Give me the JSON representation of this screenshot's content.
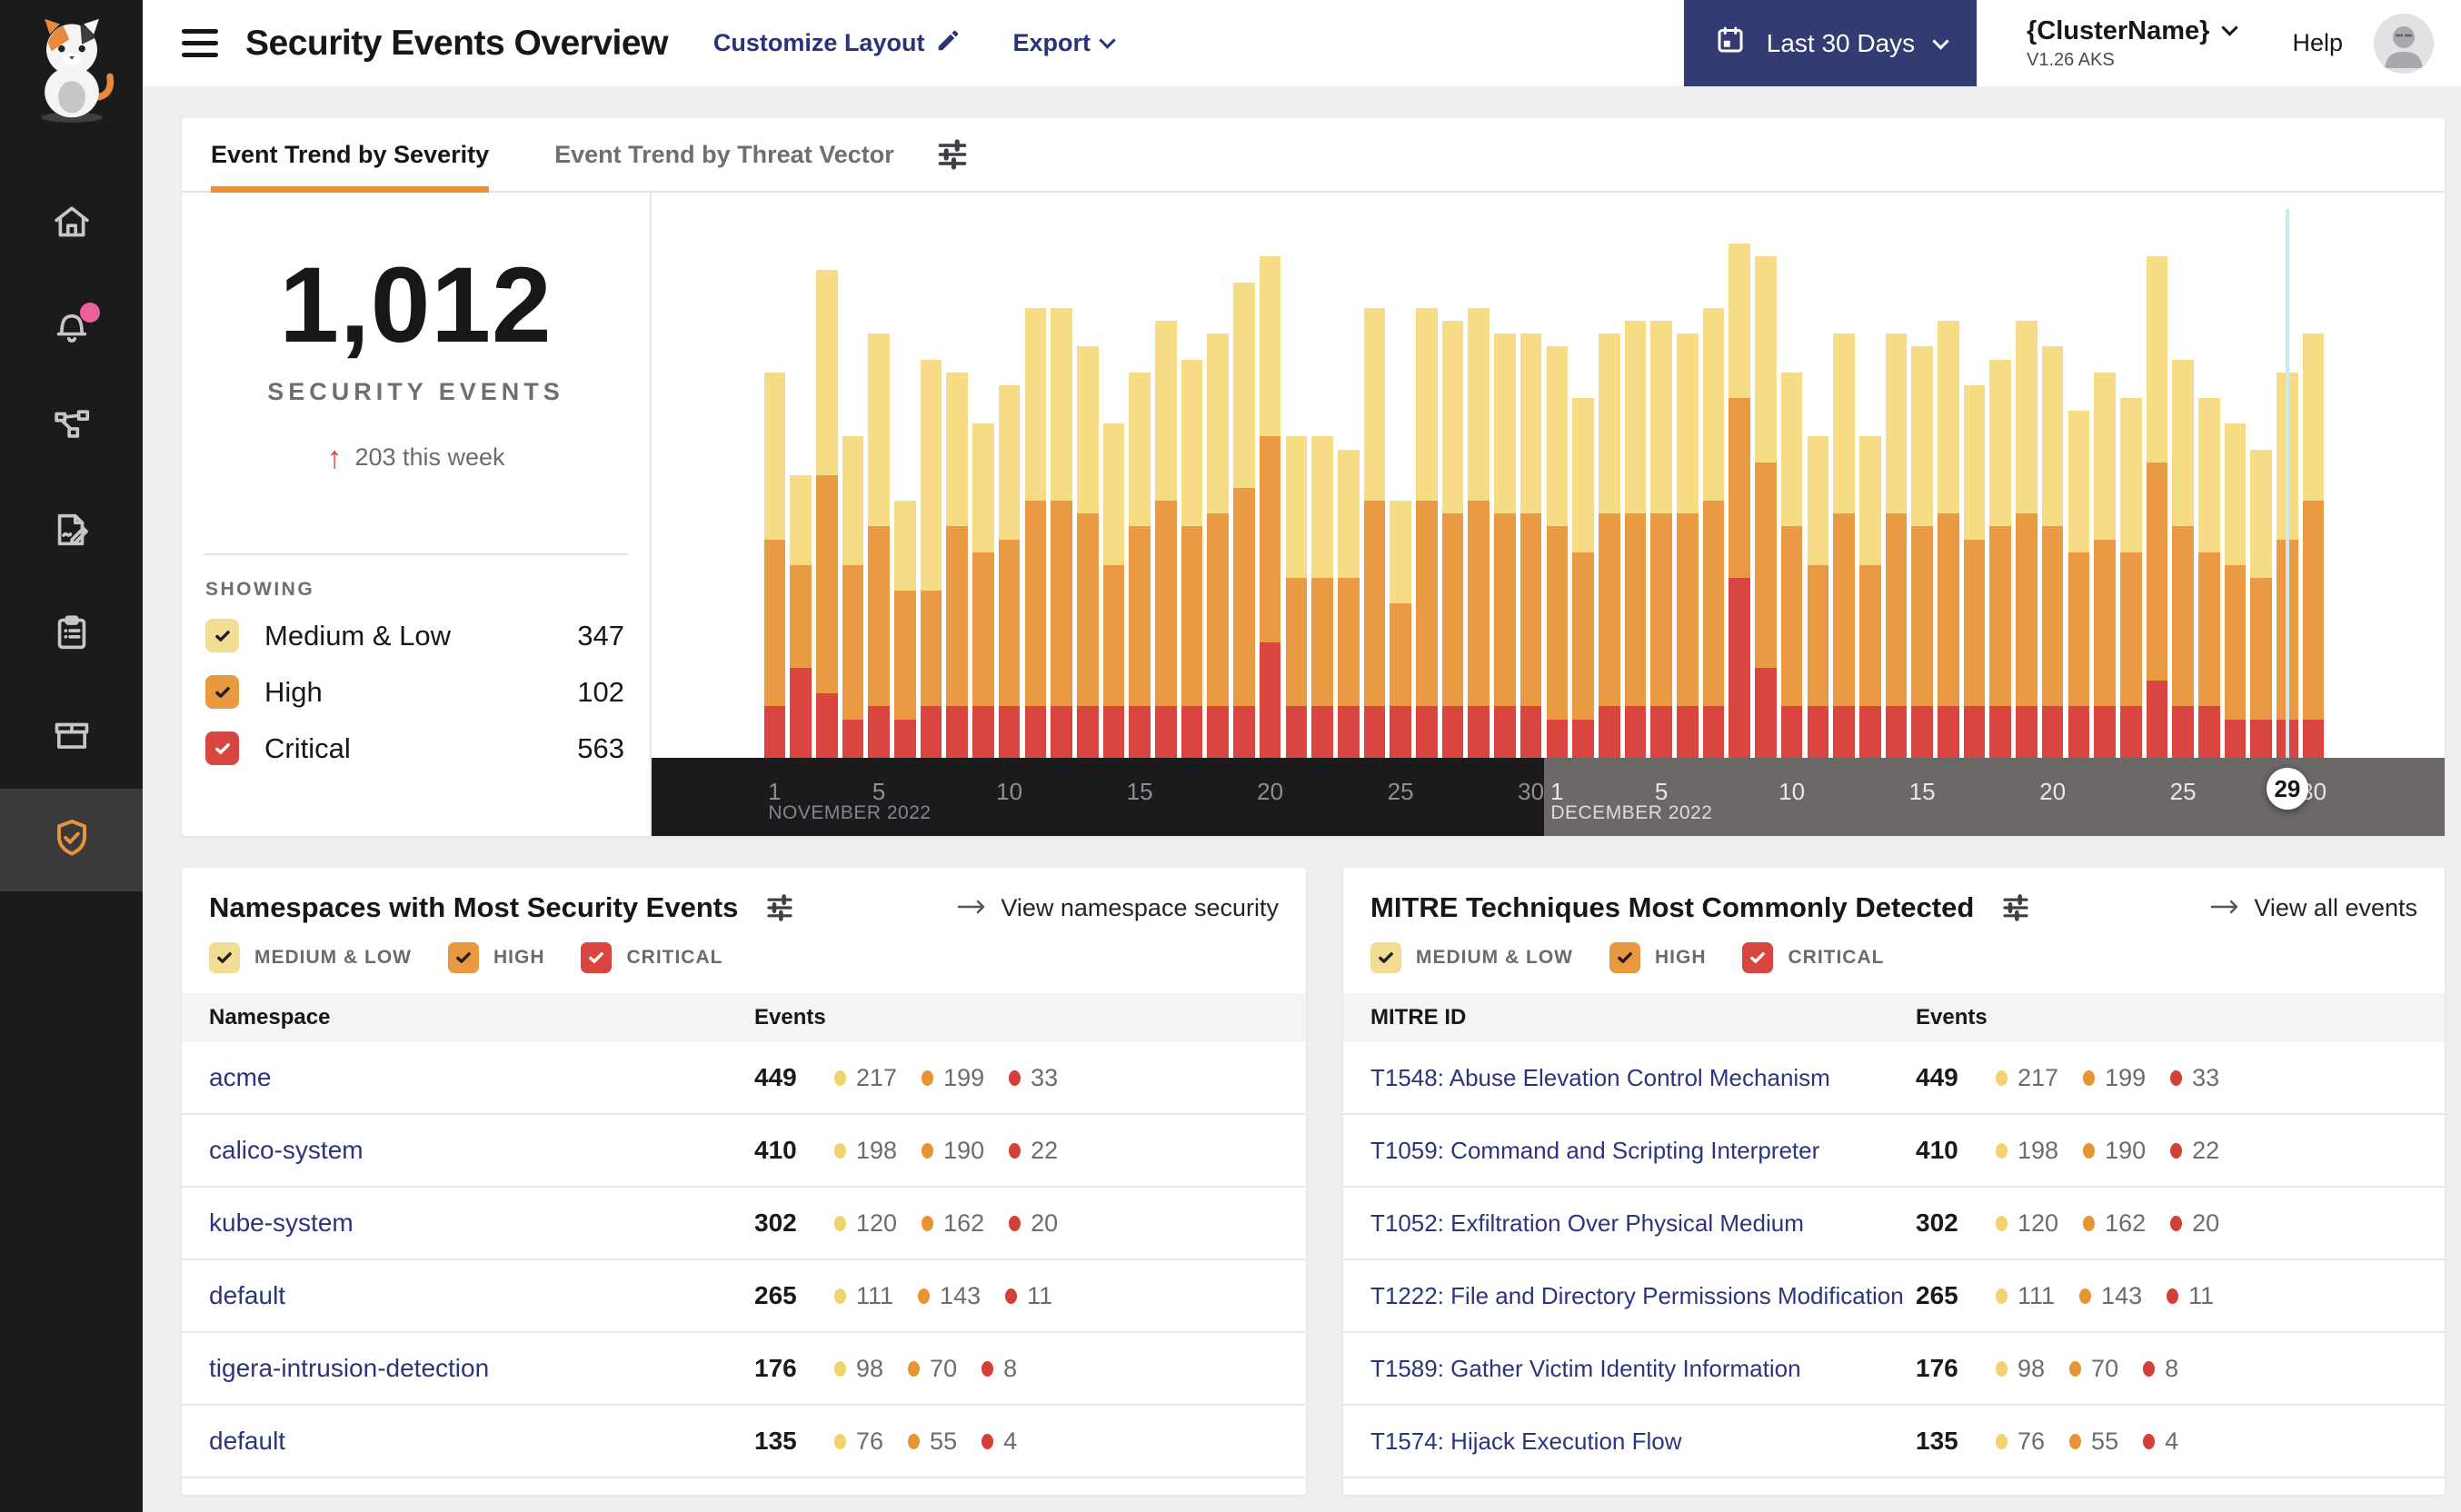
{
  "header": {
    "title": "Security Events Overview",
    "customize": "Customize Layout",
    "export": "Export",
    "date_range": "Last 30 Days",
    "cluster_name": "{ClusterName}",
    "cluster_version": "V1.26 AKS",
    "help": "Help"
  },
  "tabs": [
    {
      "label": "Event Trend by Severity",
      "active": true
    },
    {
      "label": "Event Trend by Threat Vector",
      "active": false
    }
  ],
  "stats": {
    "total": "1,012",
    "subtitle": "SECURITY EVENTS",
    "delta": "203 this week",
    "showing": "SHOWING",
    "filters": [
      {
        "severity": "medium_low",
        "label": "Medium & Low",
        "value": "347",
        "checked": true
      },
      {
        "severity": "high",
        "label": "High",
        "value": "102",
        "checked": true
      },
      {
        "severity": "critical",
        "label": "Critical",
        "value": "563",
        "checked": true
      }
    ]
  },
  "severity_styles": {
    "medium_low": {
      "checkbox": "#F3DD94",
      "check": "#1F1F24",
      "dot": "#EFD36E",
      "bar": "#F5DC85"
    },
    "high": {
      "checkbox": "#E9993F",
      "check": "#1F1F24",
      "dot": "#E89435",
      "bar": "#EA9A43"
    },
    "critical": {
      "checkbox": "#D9453F",
      "check": "#FFFFFF",
      "dot": "#D33F3A",
      "bar": "#DA463F"
    }
  },
  "colors": {
    "accent_orange": "#F09033",
    "date_button": "#333B72",
    "link_navy": "#2A357D",
    "axis_november": "#1B1B1D",
    "axis_december": "#6B6867",
    "today_line": "#CDE9F5",
    "sidebar": "#1B1B1D",
    "notification_dot": "#EC5F9B"
  },
  "chart_data": {
    "type": "bar",
    "stacked": true,
    "title": "Event Trend by Severity",
    "ylim": [
      0,
      42
    ],
    "grid": false,
    "legend_position": "none",
    "x_groups": [
      {
        "label": "NOVEMBER 2022",
        "days": 30,
        "ticks": [
          1,
          5,
          10,
          15,
          20,
          25,
          30
        ]
      },
      {
        "label": "DECEMBER 2022",
        "days": 30,
        "ticks": [
          1,
          5,
          10,
          15,
          20,
          25,
          30
        ]
      }
    ],
    "highlight": {
      "group": 1,
      "day": 29,
      "label": "29"
    },
    "series": [
      {
        "name": "Medium & Low",
        "severity": "medium_low",
        "values": [
          13,
          7,
          16,
          10,
          15,
          7,
          18,
          12,
          10,
          12,
          15,
          15,
          13,
          11,
          12,
          14,
          13,
          14,
          16,
          14,
          11,
          11,
          10,
          15,
          8,
          15,
          15,
          15,
          14,
          14,
          14,
          12,
          14,
          15,
          15,
          14,
          15,
          12,
          16,
          12,
          10,
          14,
          10,
          14,
          14,
          15,
          12,
          13,
          15,
          14,
          11,
          13,
          12,
          16,
          13,
          12,
          11,
          10,
          13,
          13
        ]
      },
      {
        "name": "High",
        "severity": "high",
        "values": [
          13,
          8,
          17,
          12,
          14,
          10,
          9,
          14,
          12,
          13,
          16,
          16,
          15,
          11,
          14,
          16,
          14,
          15,
          17,
          16,
          10,
          10,
          10,
          16,
          8,
          16,
          15,
          16,
          15,
          15,
          15,
          13,
          15,
          15,
          15,
          15,
          16,
          14,
          16,
          14,
          11,
          15,
          11,
          15,
          14,
          15,
          13,
          14,
          15,
          14,
          12,
          13,
          12,
          17,
          14,
          12,
          12,
          11,
          14,
          17
        ]
      },
      {
        "name": "Critical",
        "severity": "critical",
        "values": [
          4,
          7,
          5,
          3,
          4,
          3,
          4,
          4,
          4,
          4,
          4,
          4,
          4,
          4,
          4,
          4,
          4,
          4,
          4,
          9,
          4,
          4,
          4,
          4,
          4,
          4,
          4,
          4,
          4,
          4,
          3,
          3,
          4,
          4,
          4,
          4,
          4,
          14,
          7,
          4,
          4,
          4,
          4,
          4,
          4,
          4,
          4,
          4,
          4,
          4,
          4,
          4,
          4,
          6,
          4,
          4,
          3,
          3,
          3,
          3
        ]
      }
    ]
  },
  "namespaces_card": {
    "title": "Namespaces with Most Security Events",
    "link": "View namespace security",
    "columns": [
      "Namespace",
      "Events"
    ],
    "filters": [
      {
        "severity": "medium_low",
        "label": "MEDIUM & LOW",
        "checked": true
      },
      {
        "severity": "high",
        "label": "HIGH",
        "checked": true
      },
      {
        "severity": "critical",
        "label": "CRITICAL",
        "checked": true
      }
    ],
    "rows": [
      {
        "name": "acme",
        "total": "449",
        "medium_low": "217",
        "high": "199",
        "critical": "33"
      },
      {
        "name": "calico-system",
        "total": "410",
        "medium_low": "198",
        "high": "190",
        "critical": "22"
      },
      {
        "name": "kube-system",
        "total": "302",
        "medium_low": "120",
        "high": "162",
        "critical": "20"
      },
      {
        "name": "default",
        "total": "265",
        "medium_low": "111",
        "high": "143",
        "critical": "11"
      },
      {
        "name": "tigera-intrusion-detection",
        "total": "176",
        "medium_low": "98",
        "high": "70",
        "critical": "8"
      },
      {
        "name": "default",
        "total": "135",
        "medium_low": "76",
        "high": "55",
        "critical": "4"
      }
    ]
  },
  "mitre_card": {
    "title": "MITRE Techniques Most Commonly Detected",
    "link": "View all events",
    "columns": [
      "MITRE ID",
      "Events"
    ],
    "filters": [
      {
        "severity": "medium_low",
        "label": "MEDIUM & LOW",
        "checked": true
      },
      {
        "severity": "high",
        "label": "HIGH",
        "checked": true
      },
      {
        "severity": "critical",
        "label": "CRITICAL",
        "checked": true
      }
    ],
    "rows": [
      {
        "name": "T1548: Abuse Elevation Control Mechanism",
        "total": "449",
        "medium_low": "217",
        "high": "199",
        "critical": "33"
      },
      {
        "name": "T1059: Command and Scripting Interpreter",
        "total": "410",
        "medium_low": "198",
        "high": "190",
        "critical": "22"
      },
      {
        "name": "T1052: Exfiltration Over Physical Medium",
        "total": "302",
        "medium_low": "120",
        "high": "162",
        "critical": "20"
      },
      {
        "name": "T1222: File and Directory Permissions Modification",
        "total": "265",
        "medium_low": "111",
        "high": "143",
        "critical": "11"
      },
      {
        "name": "T1589: Gather Victim Identity Information",
        "total": "176",
        "medium_low": "98",
        "high": "70",
        "critical": "8"
      },
      {
        "name": "T1574: Hijack Execution Flow",
        "total": "135",
        "medium_low": "76",
        "high": "55",
        "critical": "4"
      }
    ]
  }
}
